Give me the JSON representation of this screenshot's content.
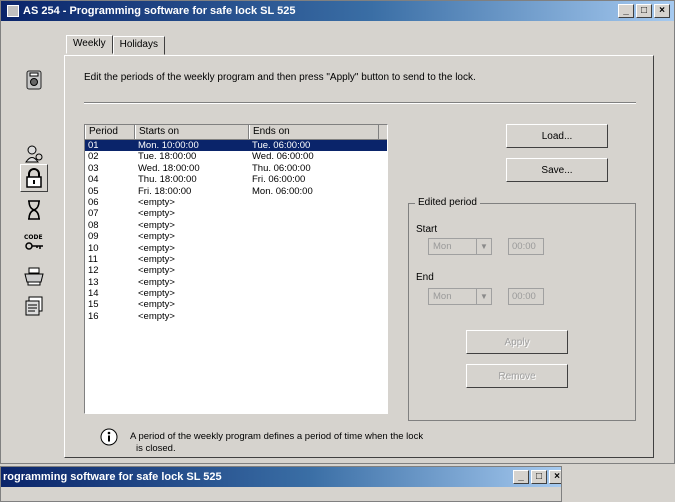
{
  "window": {
    "title": "AS 254 - Programming software for safe lock SL 525",
    "minimize": "_",
    "maximize": "□",
    "close": "×"
  },
  "tabs": [
    {
      "label": "Weekly",
      "active": true
    },
    {
      "label": "Holidays",
      "active": false
    }
  ],
  "toolbar_icons": [
    "safe-lock-icon",
    "user-keys-icon",
    "padlock-icon",
    "hourglass-icon",
    "code-key-icon",
    "printer-icon",
    "files-icon"
  ],
  "instruction": "Edit the periods of the weekly program and then press \"Apply\" button to send to the lock.",
  "list": {
    "headers": [
      "Period",
      "Starts on",
      "Ends on"
    ],
    "rows": [
      {
        "period": "01",
        "start": "Mon. 10:00:00",
        "end": "Tue. 06:00:00",
        "selected": true
      },
      {
        "period": "02",
        "start": "Tue. 18:00:00",
        "end": "Wed. 06:00:00"
      },
      {
        "period": "03",
        "start": "Wed. 18:00:00",
        "end": "Thu. 06:00:00"
      },
      {
        "period": "04",
        "start": "Thu. 18:00:00",
        "end": "Fri. 06:00:00"
      },
      {
        "period": "05",
        "start": "Fri. 18:00:00",
        "end": "Mon. 06:00:00"
      },
      {
        "period": "06",
        "start": "<empty>",
        "end": ""
      },
      {
        "period": "07",
        "start": "<empty>",
        "end": ""
      },
      {
        "period": "08",
        "start": "<empty>",
        "end": ""
      },
      {
        "period": "09",
        "start": "<empty>",
        "end": ""
      },
      {
        "period": "10",
        "start": "<empty>",
        "end": ""
      },
      {
        "period": "11",
        "start": "<empty>",
        "end": ""
      },
      {
        "period": "12",
        "start": "<empty>",
        "end": ""
      },
      {
        "period": "13",
        "start": "<empty>",
        "end": ""
      },
      {
        "period": "14",
        "start": "<empty>",
        "end": ""
      },
      {
        "period": "15",
        "start": "<empty>",
        "end": ""
      },
      {
        "period": "16",
        "start": "<empty>",
        "end": ""
      }
    ]
  },
  "buttons": {
    "load": "Load...",
    "save": "Save...",
    "apply": "Apply",
    "remove": "Remove"
  },
  "edited_period": {
    "legend": "Edited period",
    "start_label": "Start",
    "start_day": "Mon",
    "start_time": "00:00",
    "end_label": "End",
    "end_day": "Mon",
    "end_time": "00:00"
  },
  "info": {
    "text_line1": "A period of the weekly program defines a period of time when the lock",
    "text_line2": "is closed."
  },
  "window2": {
    "title": "rogramming software for safe lock SL 525"
  },
  "colors": {
    "title_bar": "#0a246a",
    "selection": "#0a246a",
    "face": "#d6d3ce"
  }
}
